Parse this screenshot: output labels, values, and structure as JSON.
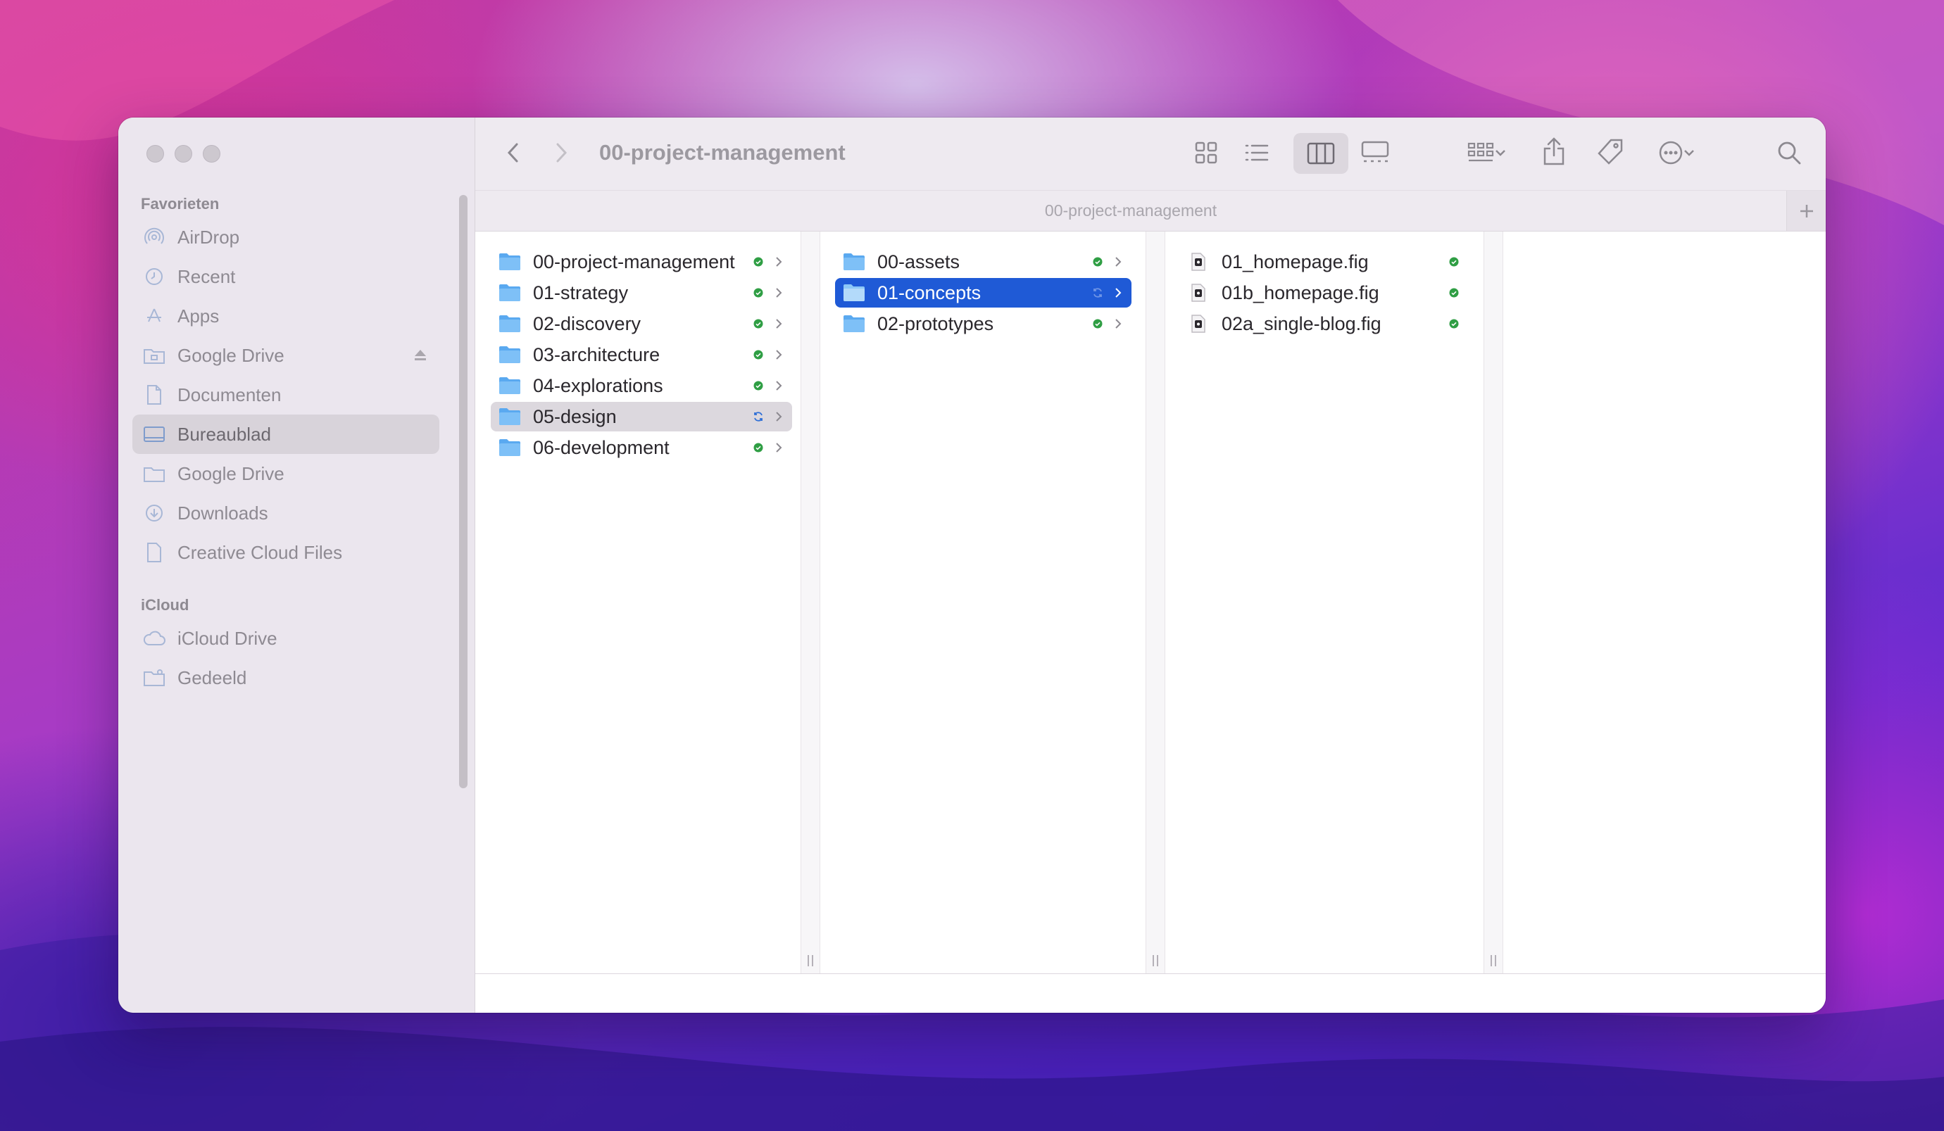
{
  "window": {
    "title": "00-project-management",
    "path_bar": "00-project-management"
  },
  "sidebar": {
    "sections": [
      {
        "heading": "Favorieten",
        "items": [
          {
            "label": "AirDrop",
            "icon": "airdrop-icon",
            "active": false
          },
          {
            "label": "Recent",
            "icon": "clock-icon",
            "active": false
          },
          {
            "label": "Apps",
            "icon": "apps-icon",
            "active": false
          },
          {
            "label": "Google Drive",
            "icon": "drive-icon",
            "active": false,
            "eject": true
          },
          {
            "label": "Documenten",
            "icon": "document-icon",
            "active": false
          },
          {
            "label": "Bureaublad",
            "icon": "desktop-icon",
            "active": true
          },
          {
            "label": "Google Drive",
            "icon": "folder-icon",
            "active": false
          },
          {
            "label": "Downloads",
            "icon": "download-icon",
            "active": false
          },
          {
            "label": "Creative Cloud Files",
            "icon": "file-icon",
            "active": false
          }
        ]
      },
      {
        "heading": "iCloud",
        "items": [
          {
            "label": "iCloud Drive",
            "icon": "cloud-icon",
            "active": false
          },
          {
            "label": "Gedeeld",
            "icon": "shared-folder-icon",
            "active": false
          }
        ]
      }
    ]
  },
  "columns": [
    {
      "items": [
        {
          "name": "00-project-management",
          "type": "folder",
          "status": "synced",
          "selected": ""
        },
        {
          "name": "01-strategy",
          "type": "folder",
          "status": "synced",
          "selected": ""
        },
        {
          "name": "02-discovery",
          "type": "folder",
          "status": "synced",
          "selected": ""
        },
        {
          "name": "03-architecture",
          "type": "folder",
          "status": "synced",
          "selected": ""
        },
        {
          "name": "04-explorations",
          "type": "folder",
          "status": "synced",
          "selected": ""
        },
        {
          "name": "05-design",
          "type": "folder",
          "status": "syncing",
          "selected": "gray"
        },
        {
          "name": "06-development",
          "type": "folder",
          "status": "synced",
          "selected": ""
        }
      ]
    },
    {
      "items": [
        {
          "name": "00-assets",
          "type": "folder",
          "status": "synced",
          "selected": ""
        },
        {
          "name": "01-concepts",
          "type": "folder",
          "status": "syncing",
          "selected": "blue"
        },
        {
          "name": "02-prototypes",
          "type": "folder",
          "status": "synced",
          "selected": ""
        }
      ]
    },
    {
      "items": [
        {
          "name": "01_homepage.fig",
          "type": "file",
          "status": "synced",
          "selected": ""
        },
        {
          "name": "01b_homepage.fig",
          "type": "file",
          "status": "synced",
          "selected": ""
        },
        {
          "name": "02a_single-blog.fig",
          "type": "file",
          "status": "synced",
          "selected": ""
        }
      ]
    }
  ],
  "colors": {
    "selection_blue": "#1f5ad6",
    "folder_blue": "#5aa9f0",
    "sync_green": "#2f9e44"
  }
}
